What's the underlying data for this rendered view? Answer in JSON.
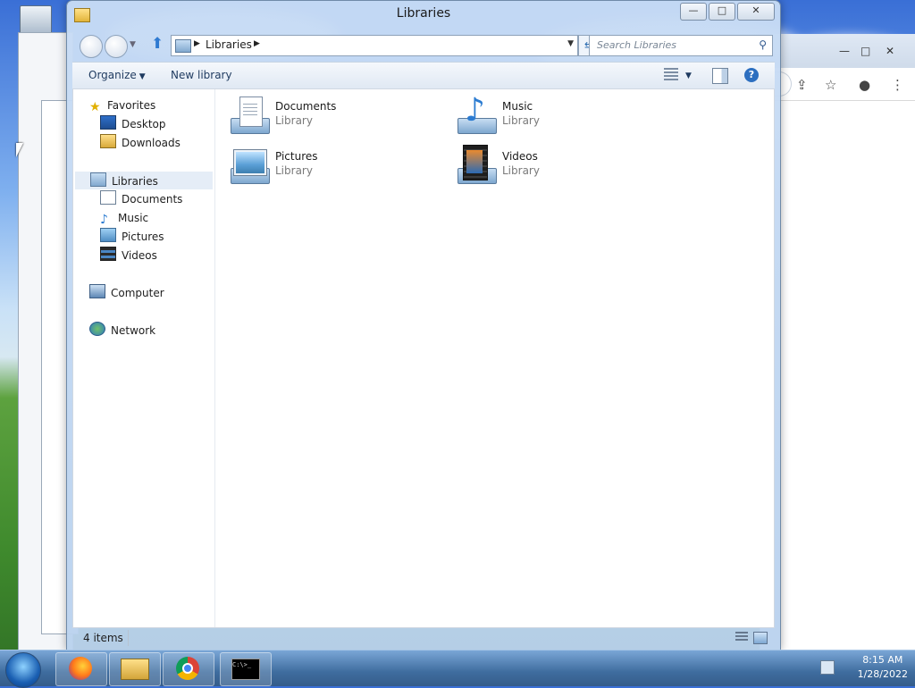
{
  "window": {
    "title": "Libraries",
    "controls": {
      "minimize": "—",
      "maximize": "□",
      "close": "✕"
    }
  },
  "address": {
    "path": "Libraries",
    "search_placeholder": "Search Libraries"
  },
  "toolbar": {
    "organize": "Organize",
    "new_library": "New library"
  },
  "nav": {
    "favorites": "Favorites",
    "desktop": "Desktop",
    "downloads": "Downloads",
    "libraries": "Libraries",
    "documents": "Documents",
    "music": "Music",
    "pictures": "Pictures",
    "videos": "Videos",
    "computer": "Computer",
    "network": "Network"
  },
  "items": [
    {
      "name": "Documents",
      "type": "Library"
    },
    {
      "name": "Music",
      "type": "Library"
    },
    {
      "name": "Pictures",
      "type": "Library"
    },
    {
      "name": "Videos",
      "type": "Library"
    }
  ],
  "status": {
    "count": "4 items"
  },
  "taskbar": {
    "time": "8:15 AM",
    "date": "1/28/2022",
    "cmd_label": "C:\\>_"
  }
}
